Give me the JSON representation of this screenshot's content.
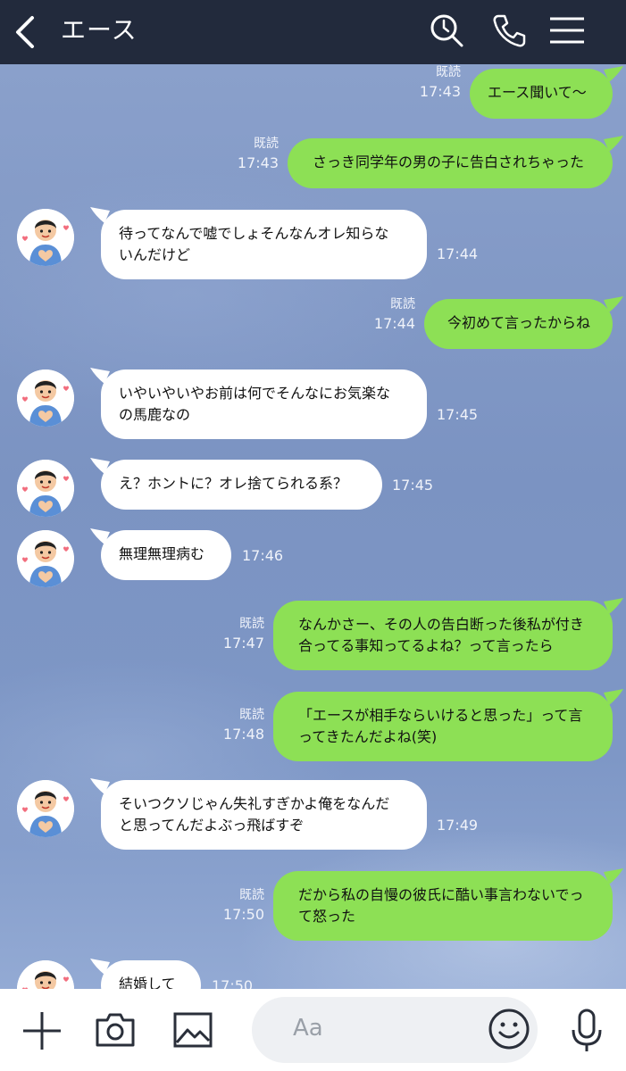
{
  "header": {
    "title": "エース",
    "icons": [
      "back-chevron-icon",
      "search-icon",
      "phone-icon",
      "menu-icon"
    ]
  },
  "messages": [
    {
      "dir": "out",
      "read": "既読",
      "time": "17:43",
      "lines": [
        "エース聞いて〜"
      ]
    },
    {
      "dir": "out",
      "read": "既読",
      "time": "17:43",
      "lines": [
        "さっき同学年の男の子に告白されちゃった"
      ]
    },
    {
      "dir": "in",
      "time": "17:44",
      "lines": [
        "待ってなんで嘘でしょそんなんオレ知らな",
        "いんだけど"
      ]
    },
    {
      "dir": "out",
      "read": "既読",
      "time": "17:44",
      "lines": [
        "今初めて言ったからね"
      ]
    },
    {
      "dir": "in",
      "time": "17:45",
      "lines": [
        "いやいやいやお前は何でそんなにお気楽な",
        "の馬鹿なの"
      ]
    },
    {
      "dir": "in",
      "time": "17:45",
      "lines": [
        "え？ホントに？オレ捨てられる系？"
      ]
    },
    {
      "dir": "in",
      "time": "17:46",
      "lines": [
        "無理無理病む"
      ]
    },
    {
      "dir": "out",
      "read": "既読",
      "time": "17:47",
      "lines": [
        "なんかさー、その人の告白断った後私が付き",
        "合ってる事知ってるよね？って言ったら"
      ]
    },
    {
      "dir": "out",
      "read": "既読",
      "time": "17:48",
      "lines": [
        "「エースが相手ならいけると思った」って言",
        "ってきたんだよね(笑)"
      ]
    },
    {
      "dir": "in",
      "time": "17:49",
      "lines": [
        "そいつクソじゃん失礼すぎかよ俺をなんだ",
        "と思ってんだよぶっ飛ばすぞ"
      ]
    },
    {
      "dir": "out",
      "read": "既読",
      "time": "17:50",
      "lines": [
        "だから私の自慢の彼氏に酷い事言わないでっ",
        "て怒った"
      ]
    },
    {
      "dir": "in",
      "time": "17:50",
      "lines": [
        "結婚して"
      ]
    }
  ],
  "footer": {
    "input_placeholder": "Aa",
    "icons": [
      "plus-icon",
      "camera-icon",
      "image-icon",
      "emoji-icon",
      "microphone-icon"
    ]
  },
  "colors": {
    "header_bg": "#222a3c",
    "bubble_out": "#8de055",
    "bubble_in": "#ffffff",
    "chat_bg": "#7f97c4"
  }
}
